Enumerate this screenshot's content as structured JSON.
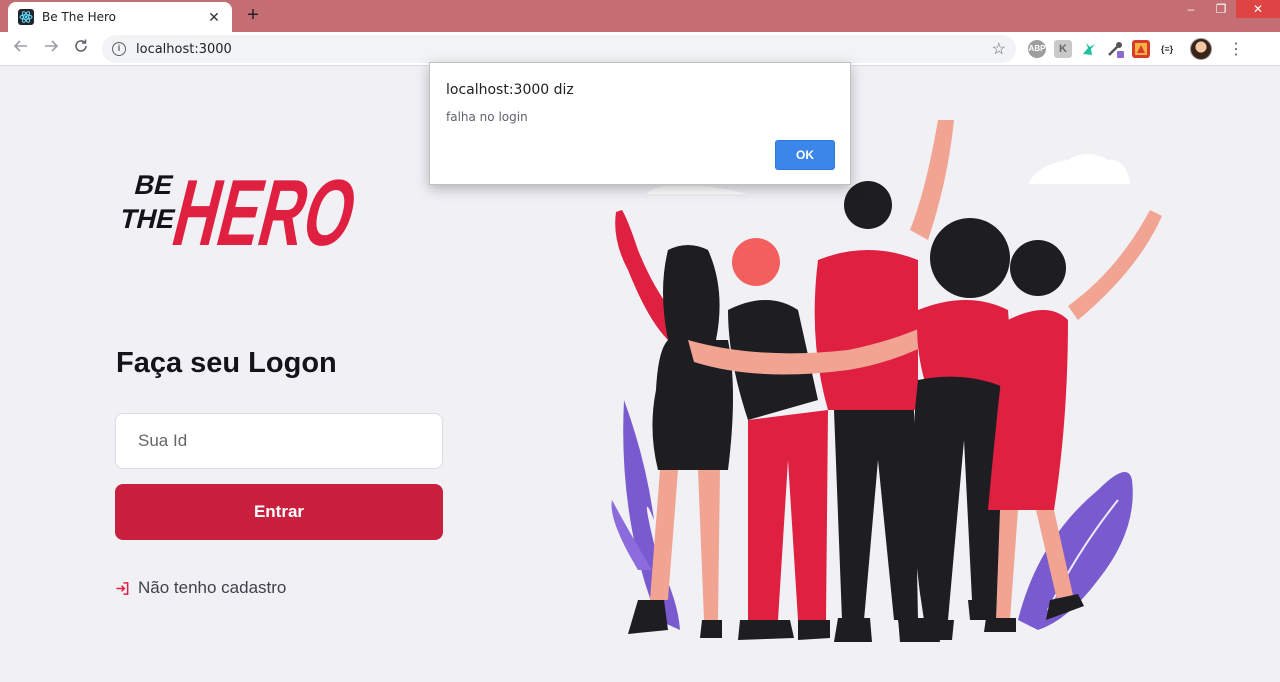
{
  "browser": {
    "tab_title": "Be The Hero",
    "tab_close": "✕",
    "new_tab": "+",
    "url": "localhost:3000",
    "window_controls": {
      "minimize": "–",
      "restore": "❐",
      "close": "✕"
    },
    "extensions": [
      "ABP",
      "K",
      "hummingbird",
      "eyedropper",
      "ext-red",
      "{≡}"
    ]
  },
  "page": {
    "logo": {
      "line1": "BE",
      "line2": "THE",
      "word": "HERO"
    },
    "title": "Faça seu Logon",
    "input_placeholder": "Sua Id",
    "submit_label": "Entrar",
    "register_link": "Não tenho cadastro",
    "colors": {
      "accent": "#e02041",
      "button": "#c8203d",
      "background": "#f0f0f5",
      "dark": "#13131a"
    }
  },
  "dialog": {
    "title": "localhost:3000 diz",
    "message": "falha no login",
    "ok_label": "OK"
  }
}
